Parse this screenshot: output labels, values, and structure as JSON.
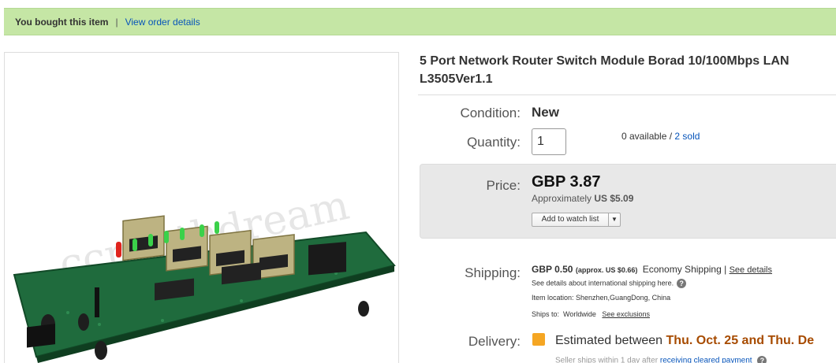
{
  "banner": {
    "bought_text": "You bought this item",
    "separator": "|",
    "order_link": "View order details"
  },
  "product": {
    "title_line1": "5 Port Network Router Switch Module Borad 10/100Mbps LAN",
    "title_line2": "L3505Ver1.1"
  },
  "condition": {
    "label": "Condition:",
    "value": "New"
  },
  "quantity": {
    "label": "Quantity:",
    "value": "1",
    "available": "0 available",
    "slash": " / ",
    "sold": "2 sold"
  },
  "price": {
    "label": "Price:",
    "value": "GBP 3.87",
    "approx_prefix": "Approximately",
    "approx_value": "US $5.09",
    "watch_label": "Add to watch list"
  },
  "shipping": {
    "label": "Shipping:",
    "cost": "GBP 0.50",
    "approx": "(approx. US $0.66)",
    "service": "Economy Shipping",
    "divider": "|",
    "see_details": "See details",
    "intl_note": "See details about international shipping here.",
    "location": "Item location:  Shenzhen,GuangDong, China",
    "ships_to_label": "Ships to:",
    "ships_to_value": "Worldwide",
    "see_exclusions": "See exclusions"
  },
  "delivery": {
    "label": "Delivery:",
    "prefix": "Estimated between",
    "dates": "Thu. Oct. 25 and Thu. De",
    "seller_text": "Seller ships within 1 day after",
    "seller_link": "receiving cleared payment"
  },
  "colors": {
    "banner_bg": "#c5e6a5",
    "link": "#0654ba",
    "delivery_dates": "#a74b00",
    "price_box": "#e8e8e8"
  }
}
